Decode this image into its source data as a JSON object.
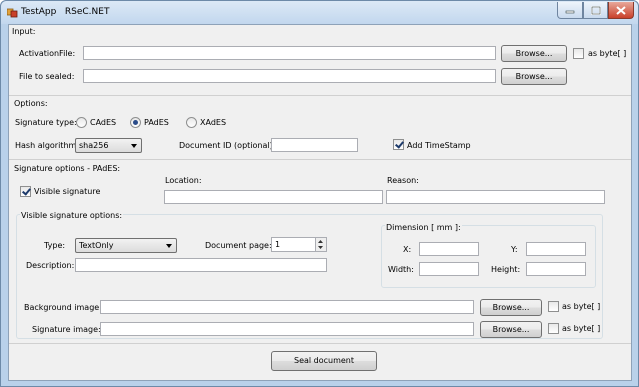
{
  "window": {
    "title": "TestApp   RSeC.NET"
  },
  "input_section": {
    "label": "Input:",
    "activation_file_label": "ActivationFile:",
    "activation_file_value": "",
    "file_to_sealed_label": "File to sealed:",
    "file_to_sealed_value": "",
    "browse_label": "Browse...",
    "as_byte_label": "as byte[ ]",
    "as_byte_checked": false
  },
  "options_section": {
    "label": "Options:",
    "signature_type_label": "Signature type:",
    "signature_types": [
      "CAdES",
      "PAdES",
      "XAdES"
    ],
    "selected_signature_type": "PAdES",
    "hash_algorithm_label": "Hash algorithm:",
    "hash_algorithm_value": "sha256",
    "document_id_label": "Document ID (optional):",
    "document_id_value": "",
    "add_timestamp_label": "Add TimeStamp",
    "add_timestamp_checked": true
  },
  "signature_options": {
    "label": "Signature options - PAdES:",
    "visible_signature_label": "Visible signature",
    "visible_signature_checked": true,
    "location_label": "Location:",
    "location_value": "",
    "reason_label": "Reason:",
    "reason_value": ""
  },
  "visible_signature_options": {
    "label": "Visible signature options:",
    "type_label": "Type:",
    "type_value": "TextOnly",
    "document_page_label": "Document page:",
    "document_page_value": "1",
    "description_label": "Description:",
    "description_value": "",
    "dimension_label": "Dimension [ mm ]:",
    "x_label": "X:",
    "y_label": "Y:",
    "width_label": "Width:",
    "height_label": "Height:",
    "x_value": "",
    "y_value": "",
    "width_value": "",
    "height_value": ""
  },
  "images": {
    "background_label": "Background image:",
    "background_value": "",
    "signature_label": "Signature image:",
    "signature_value": "",
    "browse_label": "Browse...",
    "as_byte_label": "as byte[ ]"
  },
  "seal_button_label": "Seal document",
  "colors": {
    "title_bar": "#c2d7ee",
    "close_button": "#c9402a",
    "client_background": "#f0f0f0"
  }
}
